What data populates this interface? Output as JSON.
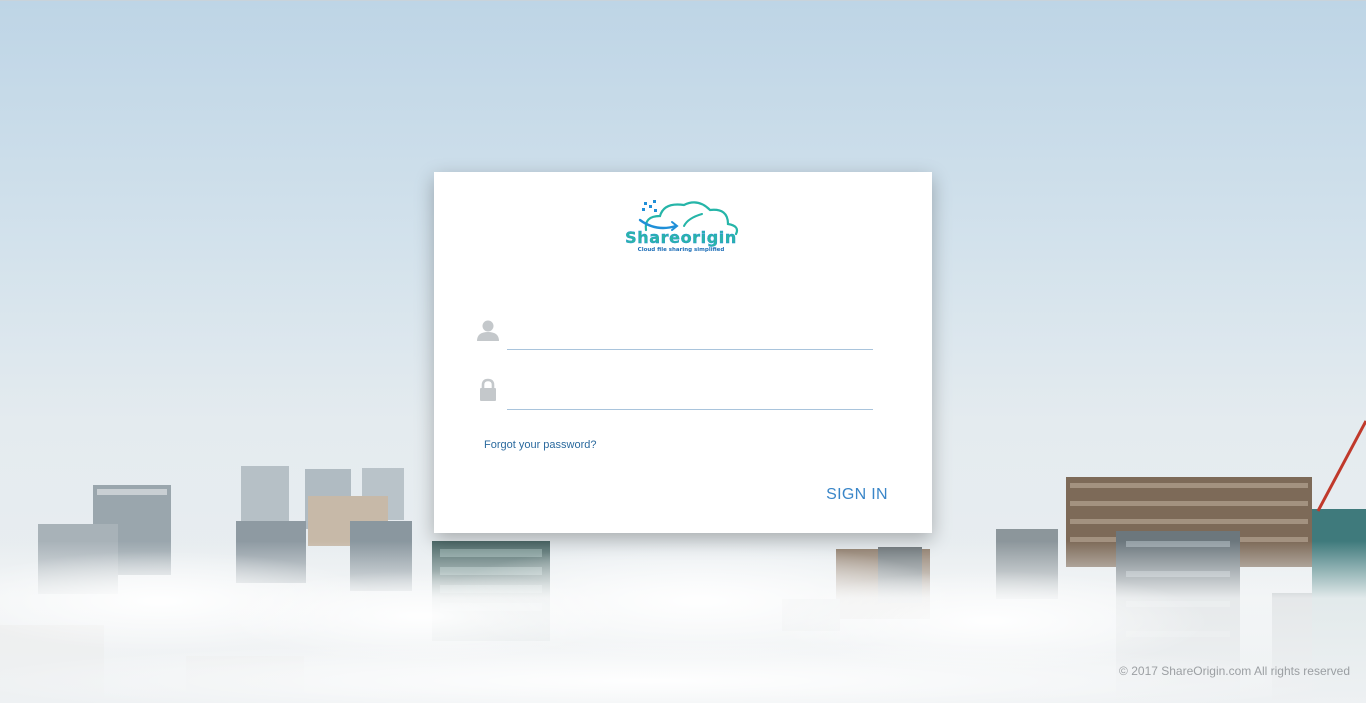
{
  "login": {
    "username": {
      "value": "",
      "placeholder": ""
    },
    "password": {
      "value": "",
      "placeholder": ""
    },
    "forgot_label": "Forgot your password?",
    "signin_label": "SIGN IN"
  },
  "logo": {
    "name": "Shareorigin",
    "tagline": "Cloud file sharing simplified"
  },
  "footer": {
    "copyright": "© 2017 ShareOrigin.com All rights reserved"
  },
  "colors": {
    "accent": "#3a86c8",
    "logo_teal": "#25b5a8",
    "logo_blue": "#1f8fd8",
    "input_underline": "#a9c4dc"
  },
  "icons": {
    "username": "user-icon",
    "password": "lock-icon"
  }
}
